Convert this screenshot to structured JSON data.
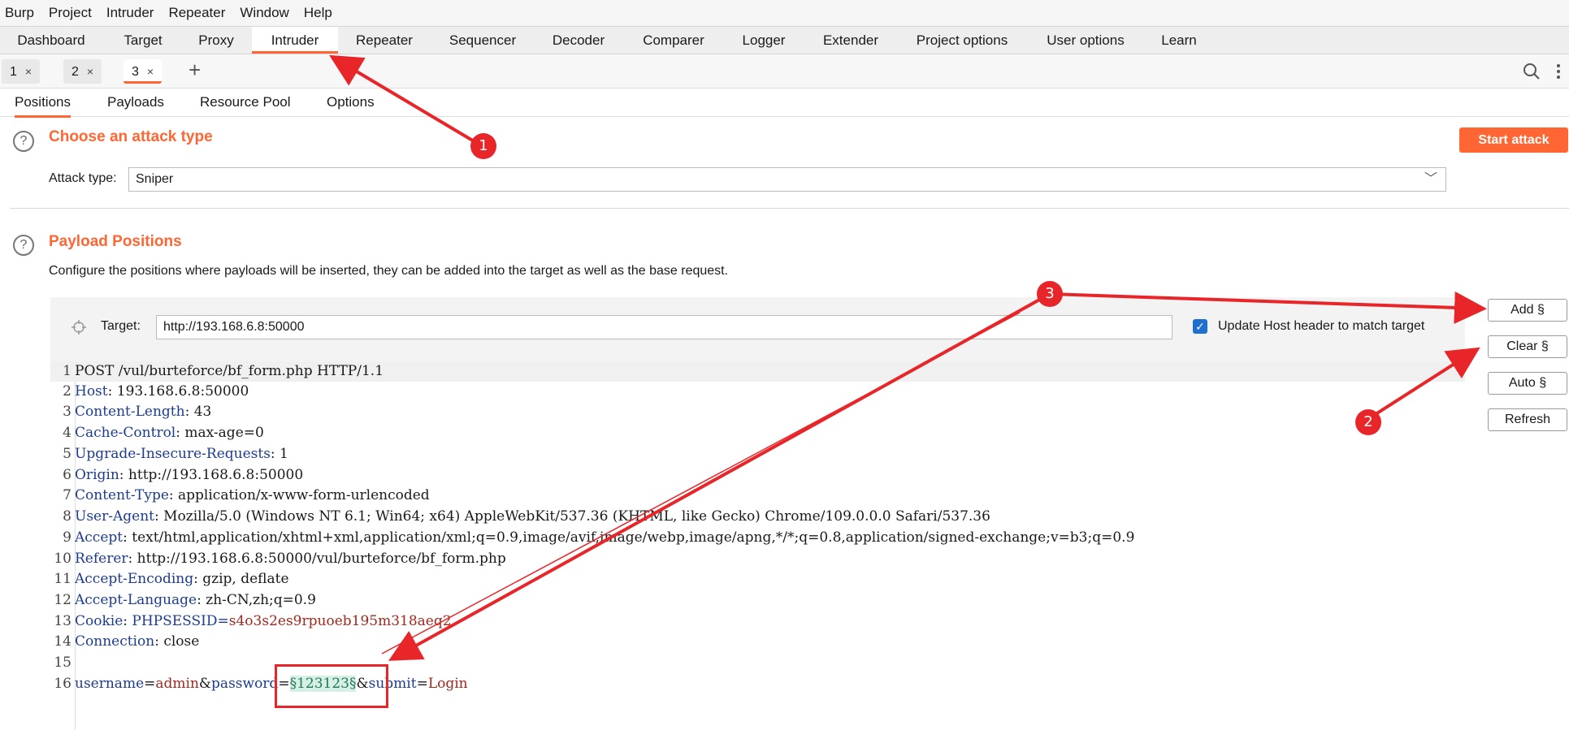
{
  "menu": [
    "Burp",
    "Project",
    "Intruder",
    "Repeater",
    "Window",
    "Help"
  ],
  "main_tabs": [
    "Dashboard",
    "Target",
    "Proxy",
    "Intruder",
    "Repeater",
    "Sequencer",
    "Decoder",
    "Comparer",
    "Logger",
    "Extender",
    "Project options",
    "User options",
    "Learn"
  ],
  "active_main_tab": "Intruder",
  "num_tabs": [
    {
      "label": "1",
      "close": "×"
    },
    {
      "label": "2",
      "close": "×"
    },
    {
      "label": "3",
      "close": "×"
    }
  ],
  "add_tab": "+",
  "section_tabs": [
    "Positions",
    "Payloads",
    "Resource Pool",
    "Options"
  ],
  "attack": {
    "help": "?",
    "heading": "Choose an attack type",
    "start_button": "Start attack",
    "type_label": "Attack type:",
    "type_value": "Sniper",
    "chevron": "﹀"
  },
  "positions": {
    "help": "?",
    "heading": "Payload Positions",
    "description": "Configure the positions where payloads will be inserted, they can be added into the target as well as the base request.",
    "target_label": "Target:",
    "target_value": "http://193.168.6.8:50000",
    "checkbox_mark": "✓",
    "update_host_label": "Update Host header to match target"
  },
  "side_buttons": {
    "add": "Add §",
    "clear": "Clear §",
    "auto": "Auto §",
    "refresh": "Refresh"
  },
  "request": {
    "l1": "POST /vul/burteforce/bf_form.php HTTP/1.1",
    "headers": [
      {
        "n": "2",
        "name": "Host",
        "value": " 193.168.6.8:50000"
      },
      {
        "n": "3",
        "name": "Content-Length",
        "value": " 43"
      },
      {
        "n": "4",
        "name": "Cache-Control",
        "value": " max-age=0"
      },
      {
        "n": "5",
        "name": "Upgrade-Insecure-Requests",
        "value": " 1"
      },
      {
        "n": "6",
        "name": "Origin",
        "value": " http://193.168.6.8:50000"
      },
      {
        "n": "7",
        "name": "Content-Type",
        "value": " application/x-www-form-urlencoded"
      },
      {
        "n": "8",
        "name": "User-Agent",
        "value": " Mozilla/5.0 (Windows NT 6.1; Win64; x64) AppleWebKit/537.36 (KHTML, like Gecko) Chrome/109.0.0.0 Safari/537.36"
      },
      {
        "n": "9",
        "name": "Accept",
        "value": " text/html,application/xhtml+xml,application/xml;q=0.9,image/avif,image/webp,image/apng,*/*;q=0.8,application/signed-exchange;v=b3;q=0.9"
      },
      {
        "n": "10",
        "name": "Referer",
        "value": " http://193.168.6.8:50000/vul/burteforce/bf_form.php"
      },
      {
        "n": "11",
        "name": "Accept-Encoding",
        "value": " gzip, deflate"
      },
      {
        "n": "12",
        "name": "Accept-Language",
        "value": " zh-CN,zh;q=0.9"
      }
    ],
    "cookie_name": "Cookie",
    "cookie_key": " PHPSESSID=",
    "cookie_value": "s4o3s2es9rpuoeb195m318aeq2",
    "connection_name": "Connection",
    "connection_value": " close",
    "body": {
      "k1": "username",
      "eq1": "=",
      "v1": "admin",
      "amp1": "&",
      "k2": "password",
      "eq2": "=",
      "payload": "§123123§",
      "amp2": "&",
      "k3": "submit",
      "eq3": "=",
      "v3": "Login"
    }
  },
  "annotations": {
    "a1": "1",
    "a2": "2",
    "a3": "3",
    "color": "#e8262a"
  },
  "colors": {
    "accent": "#ff6633",
    "header_name": "#1d3c8f",
    "value_red": "#a0281e",
    "payload_bg": "#d6f0e6"
  }
}
